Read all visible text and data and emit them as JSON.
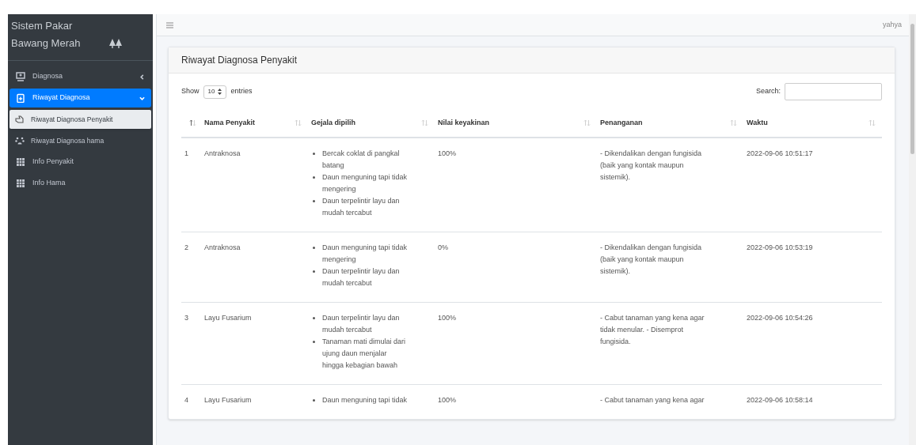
{
  "sidebar": {
    "brand": "Sistem Pakar Bawang Merah",
    "items": [
      {
        "label": "Diagnosa",
        "selected": false,
        "expanded": false
      },
      {
        "label": "Riwayat Diagnosa",
        "selected": true,
        "expanded": true,
        "children": [
          {
            "label": "Riwayat Diagnosa Penyakit",
            "selected": true
          },
          {
            "label": "Riwayat Diagnosa hama",
            "selected": false
          }
        ]
      },
      {
        "label": "Info Penyakit",
        "selected": false
      },
      {
        "label": "Info Hama",
        "selected": false
      }
    ]
  },
  "navbar": {
    "user": "yahya"
  },
  "card": {
    "title": "Riwayat Diagnosa Penyakit",
    "length_menu": {
      "before": "Show",
      "value": "10",
      "after": "entries"
    },
    "search": {
      "label": "Search:"
    },
    "table": {
      "columns": [
        {
          "sorted": true
        },
        {
          "label": "Nama Penyakit",
          "sorted": false
        },
        {
          "label": "Gejala dipilih",
          "sorted": false
        },
        {
          "label": "Nilai keyakinan",
          "sorted": false
        },
        {
          "label": "Penanganan",
          "sorted": false
        },
        {
          "label": "Waktu",
          "sorted": false
        }
      ],
      "rows": [
        {
          "no": "1",
          "name": "Antraknosa",
          "symptoms": [
            "Bercak coklat di pangkal batang",
            "Daun menguning tapi tidak mengering",
            "Daun terpelintir layu dan mudah tercabut"
          ],
          "confidence": "100%",
          "treatment": "- Dikendalikan dengan fungisida (baik yang kontak maupun sistemik).",
          "time": "2022-09-06 10:51:17"
        },
        {
          "no": "2",
          "name": "Antraknosa",
          "symptoms": [
            "Daun menguning tapi tidak mengering",
            "Daun terpelintir layu dan mudah tercabut"
          ],
          "confidence": "0%",
          "treatment": "- Dikendalikan dengan fungisida (baik yang kontak maupun sistemik).",
          "time": "2022-09-06 10:53:19"
        },
        {
          "no": "3",
          "name": "Layu Fusarium",
          "symptoms": [
            "Daun terpelintir layu dan mudah tercabut",
            "Tanaman mati dimulai dari ujung daun menjalar hingga kebagian bawah"
          ],
          "confidence": "100%",
          "treatment": "- Cabut tanaman yang kena agar tidak menular. - Disemprot fungisida.",
          "time": "2022-09-06 10:54:26"
        },
        {
          "no": "4",
          "name": "Layu Fusarium",
          "symptoms": [
            "Daun menguning tapi tidak"
          ],
          "confidence": "100%",
          "treatment": "- Cabut tanaman yang kena agar",
          "time": "2022-09-06 10:58:14"
        }
      ]
    }
  }
}
